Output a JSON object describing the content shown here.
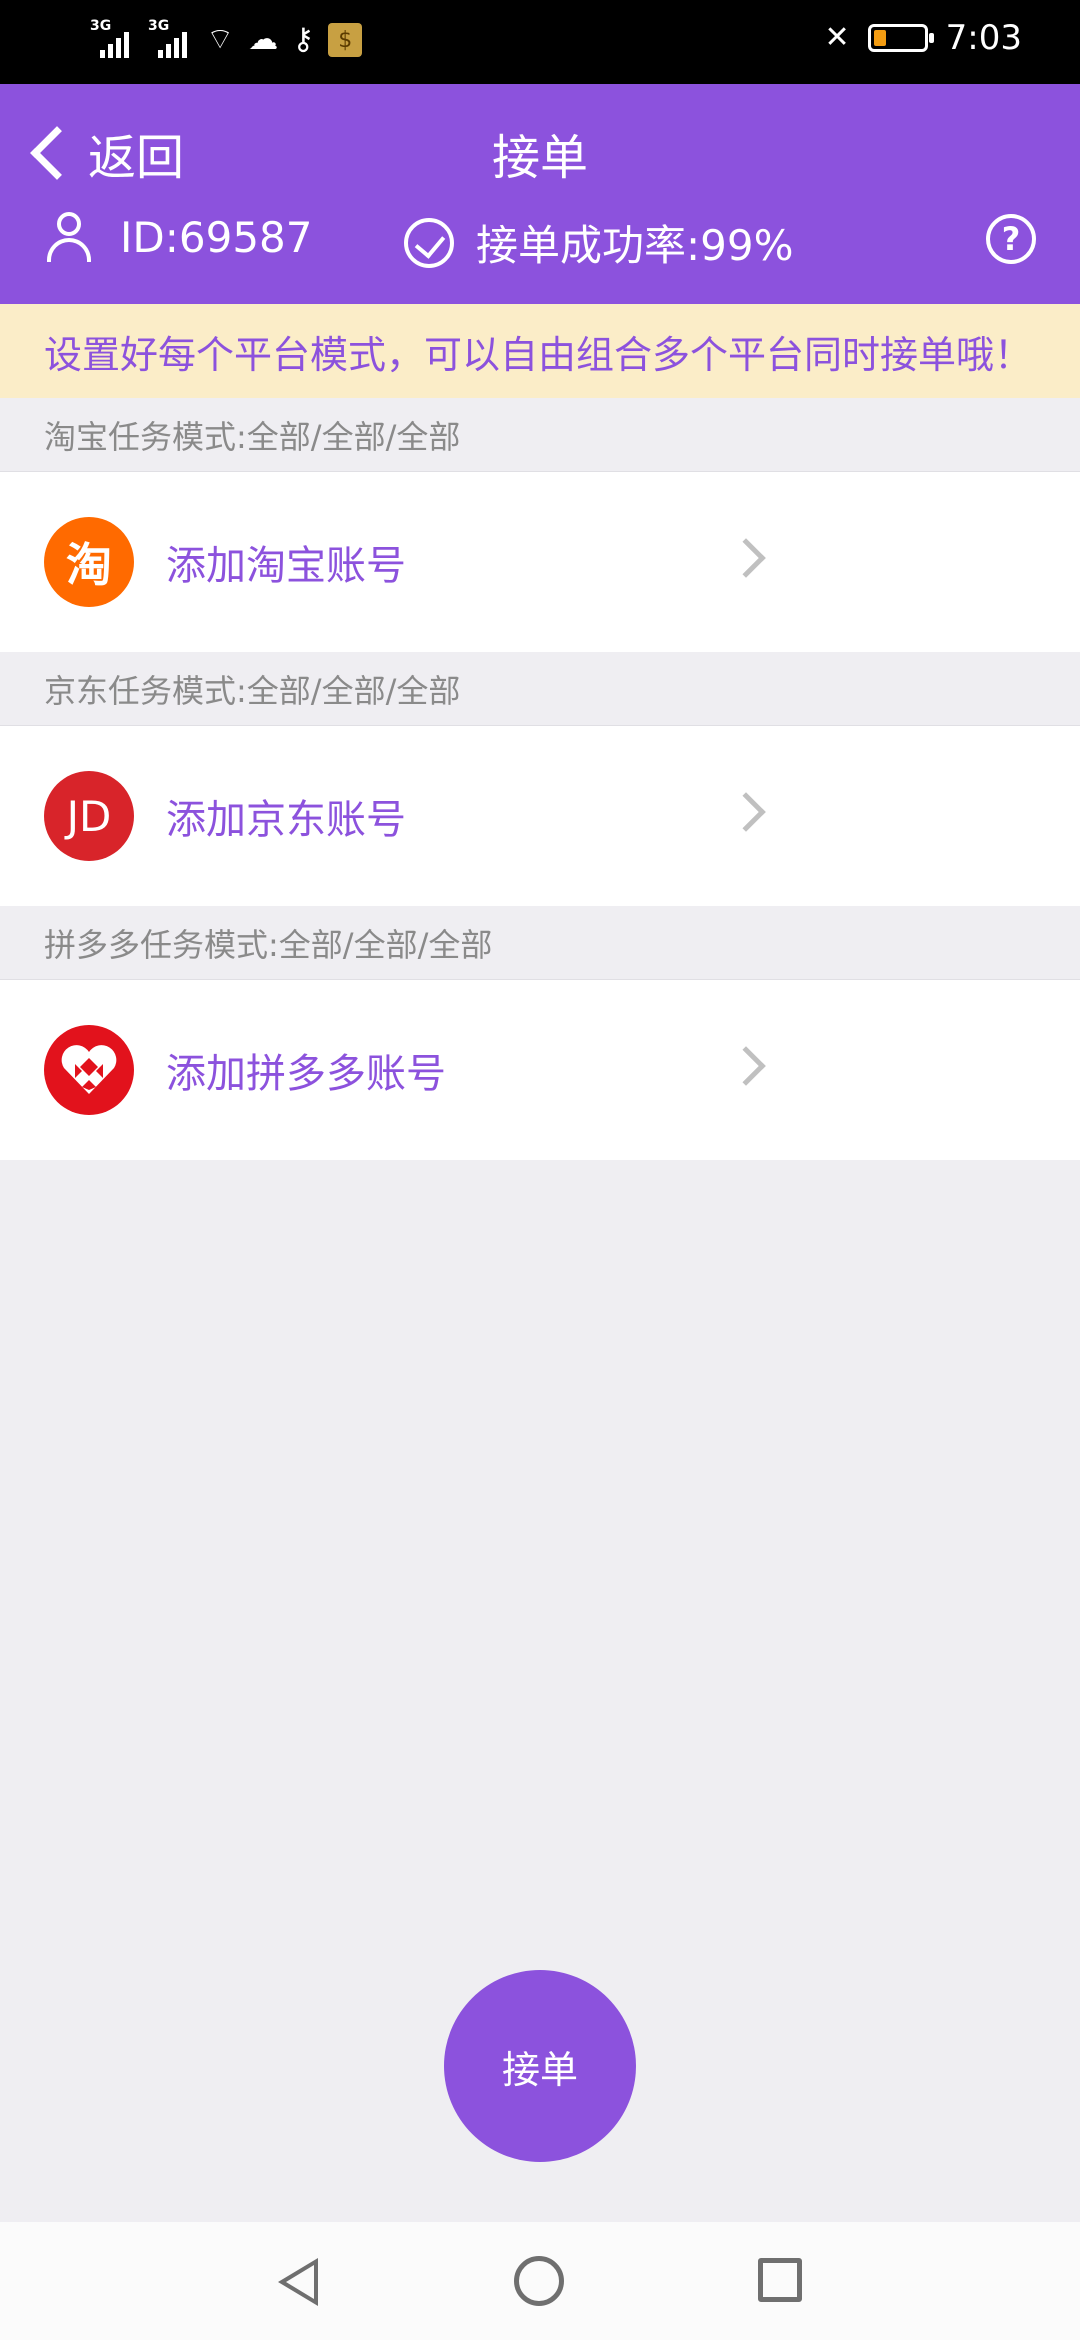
{
  "status_bar": {
    "network_tags": [
      "3G",
      "3G"
    ],
    "time": "7:03"
  },
  "header": {
    "back_label": "返回",
    "title": "接单",
    "user_id": "ID:69587",
    "success_rate": "接单成功率:99%"
  },
  "notice": "设置好每个平台模式，可以自由组合多个平台同时接单哦！",
  "sections": [
    {
      "mode_label": "淘宝任务模式:全部/全部/全部",
      "account_label": "添加淘宝账号",
      "logo_text": "淘",
      "logo_color": "#ff6a00"
    },
    {
      "mode_label": "京东任务模式:全部/全部/全部",
      "account_label": "添加京东账号",
      "logo_text": "JD",
      "logo_color": "#d8242a"
    },
    {
      "mode_label": "拼多多任务模式:全部/全部/全部",
      "account_label": "添加拼多多账号",
      "logo_text": "",
      "logo_color": "#e2121c"
    }
  ],
  "accept_button": "接单",
  "colors": {
    "accent": "#8c52dd",
    "notice_bg": "#fbedc8"
  }
}
